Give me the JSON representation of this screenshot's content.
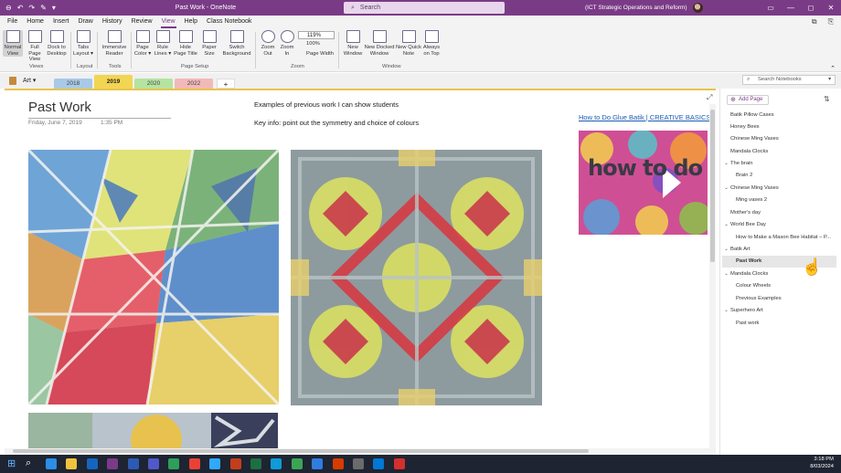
{
  "app": {
    "title": "Past Work - OneNote",
    "search_placeholder": "Search",
    "account": "(ICT Strategic Operations and Reform)",
    "window_buttons": [
      "—",
      "◻",
      "✕"
    ]
  },
  "menu": {
    "items": [
      "File",
      "Home",
      "Insert",
      "Draw",
      "History",
      "Review",
      "View",
      "Help",
      "Class Notebook"
    ],
    "active": "View"
  },
  "ribbon": {
    "buttons": [
      {
        "id": "normal-view",
        "label": "Normal\nView"
      },
      {
        "id": "full-page-view",
        "label": "Full Page\nView"
      },
      {
        "id": "dock-to-desktop",
        "label": "Dock to\nDesktop"
      },
      {
        "id": "tabs-layout",
        "label": "Tabs\nLayout ▾"
      },
      {
        "id": "immersive-reader",
        "label": "Immersive\nReader"
      },
      {
        "id": "page-color",
        "label": "Page\nColor ▾"
      },
      {
        "id": "rule-lines",
        "label": "Rule\nLines ▾"
      },
      {
        "id": "hide-page-title",
        "label": "Hide\nPage Title"
      },
      {
        "id": "paper-size",
        "label": "Paper\nSize"
      },
      {
        "id": "switch-background",
        "label": "Switch\nBackground"
      },
      {
        "id": "zoom-out",
        "label": "Zoom\nOut"
      },
      {
        "id": "zoom-in",
        "label": "Zoom\nIn"
      },
      {
        "id": "new-window",
        "label": "New\nWindow"
      },
      {
        "id": "new-docked-window",
        "label": "New Docked\nWindow"
      },
      {
        "id": "new-quick-note",
        "label": "New Quick\nNote"
      },
      {
        "id": "always-on-top",
        "label": "Always\non Top"
      }
    ],
    "zoom_value": "119%",
    "zoom_100": "100%",
    "page_width": "Page Width",
    "groups": [
      "Views",
      "Layout",
      "Tools",
      "Page Setup",
      "Zoom",
      "Window"
    ]
  },
  "section": {
    "notebook": "Art",
    "tabs": [
      {
        "label": "2018",
        "color": "#a9c9e8"
      },
      {
        "label": "2019",
        "color": "#f2d553"
      },
      {
        "label": "2020",
        "color": "#b5e3a1"
      },
      {
        "label": "2022",
        "color": "#f2b9b9"
      }
    ],
    "active_tab": "2019",
    "add_label": "+",
    "search_placeholder": "Search Notebooks"
  },
  "page": {
    "title": "Past Work",
    "date": "Friday, June 7, 2019",
    "time": "1:35 PM",
    "note1": "Examples of previous work I can show students",
    "note2": "Key info: point out the symmetry and choice of colours",
    "link": "How to Do Glue Batik | CREATIVE BASICS",
    "video_text": "how to do glue ba"
  },
  "pages": {
    "add_label": "Add Page",
    "items": [
      {
        "label": "Batik Pillow Cases",
        "level": 0,
        "chevron": false
      },
      {
        "label": "Honey Bees",
        "level": 0,
        "chevron": false
      },
      {
        "label": "Chinese Ming Vases",
        "level": 0,
        "chevron": false
      },
      {
        "label": "Mandala Clocks",
        "level": 0,
        "chevron": false
      },
      {
        "label": "The brain",
        "level": 0,
        "chevron": true
      },
      {
        "label": "Brain 2",
        "level": 1,
        "chevron": false
      },
      {
        "label": "Chinese Ming Vases",
        "level": 0,
        "chevron": true
      },
      {
        "label": "Ming vases 2",
        "level": 1,
        "chevron": false
      },
      {
        "label": "Mother's day",
        "level": 0,
        "chevron": false
      },
      {
        "label": "World Bee Day",
        "level": 0,
        "chevron": true
      },
      {
        "label": "How to Make a Mason Bee Habitat – P...",
        "level": 1,
        "chevron": false
      },
      {
        "label": "Batik Art",
        "level": 0,
        "chevron": true
      },
      {
        "label": "Past Work",
        "level": 1,
        "chevron": false,
        "selected": true
      },
      {
        "label": "Mandala Clocks",
        "level": 0,
        "chevron": true
      },
      {
        "label": "Colour Wheels",
        "level": 1,
        "chevron": false
      },
      {
        "label": "Previous Examples",
        "level": 1,
        "chevron": false
      },
      {
        "label": "Superhero Art",
        "level": 0,
        "chevron": true
      },
      {
        "label": "Past work",
        "level": 1,
        "chevron": false
      }
    ]
  },
  "taskbar": {
    "time": "3:18 PM",
    "date": "8/03/2024",
    "apps": [
      "edge",
      "file-explorer",
      "outlook",
      "onenote",
      "word",
      "teams",
      "class-notebook",
      "chrome",
      "photoshop",
      "powerpoint",
      "excel",
      "app-12",
      "app-13",
      "app-14",
      "app-15",
      "app-16",
      "app-17",
      "acrobat"
    ]
  }
}
